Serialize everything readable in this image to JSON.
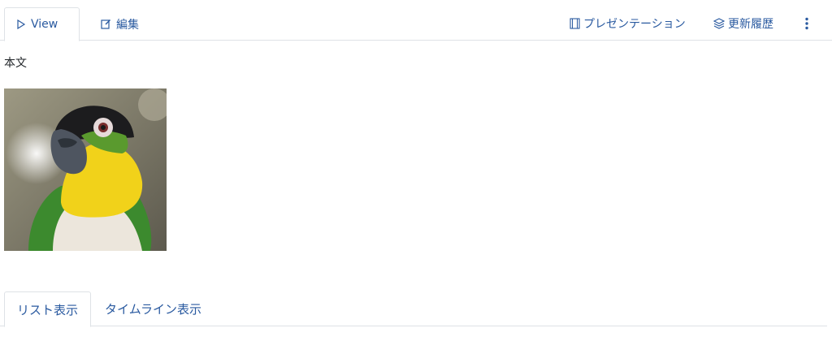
{
  "tabs": {
    "view_label": "View",
    "edit_label": "編集"
  },
  "toolbar": {
    "presentation_label": "プレゼンテーション",
    "history_label": "更新履歴"
  },
  "content": {
    "body_label": "本文",
    "image_subject": "parrot"
  },
  "bottom_tabs": {
    "list_label": "リスト表示",
    "timeline_label": "タイムライン表示"
  },
  "colors": {
    "link": "#2a5aa0",
    "border": "#dee2e6"
  }
}
